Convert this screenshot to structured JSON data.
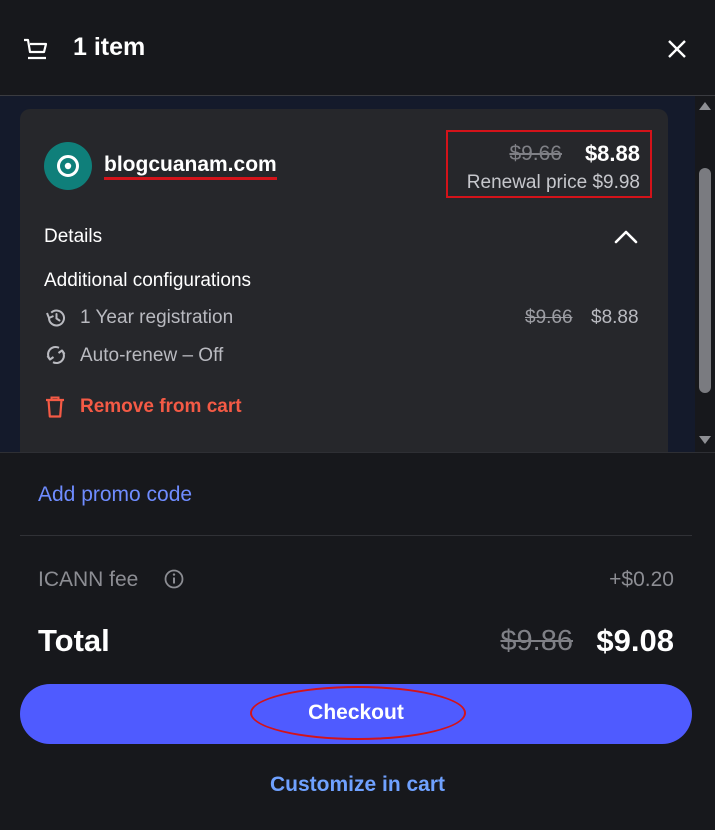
{
  "header": {
    "title": "1 item",
    "cart_icon": "cart-icon",
    "close_icon": "close-icon"
  },
  "item": {
    "domain": "blogcuanam.com",
    "logo_icon": "domain-logo-icon",
    "logo_color": "#0f7f7a",
    "old_price": "$9.66",
    "new_price": "$8.88",
    "renewal": "Renewal price $9.98",
    "details_label": "Details",
    "additional_label": "Additional configurations",
    "registration": {
      "icon": "history-icon",
      "label": "1 Year registration",
      "old_price": "$9.66",
      "new_price": "$8.88"
    },
    "autorenew": {
      "icon": "renew-icon",
      "label": "Auto-renew – Off"
    },
    "remove": {
      "icon": "trash-icon",
      "label": "Remove from cart",
      "color": "#f45a45"
    }
  },
  "summary": {
    "promo": "Add promo code",
    "icann_label": "ICANN fee",
    "icann_value": "+$0.20",
    "total_label": "Total",
    "total_old": "$9.86",
    "total_new": "$9.08",
    "checkout": "Checkout",
    "customize": "Customize in cart",
    "accent": "#4f5bff",
    "link_color": "#6f8cff"
  }
}
